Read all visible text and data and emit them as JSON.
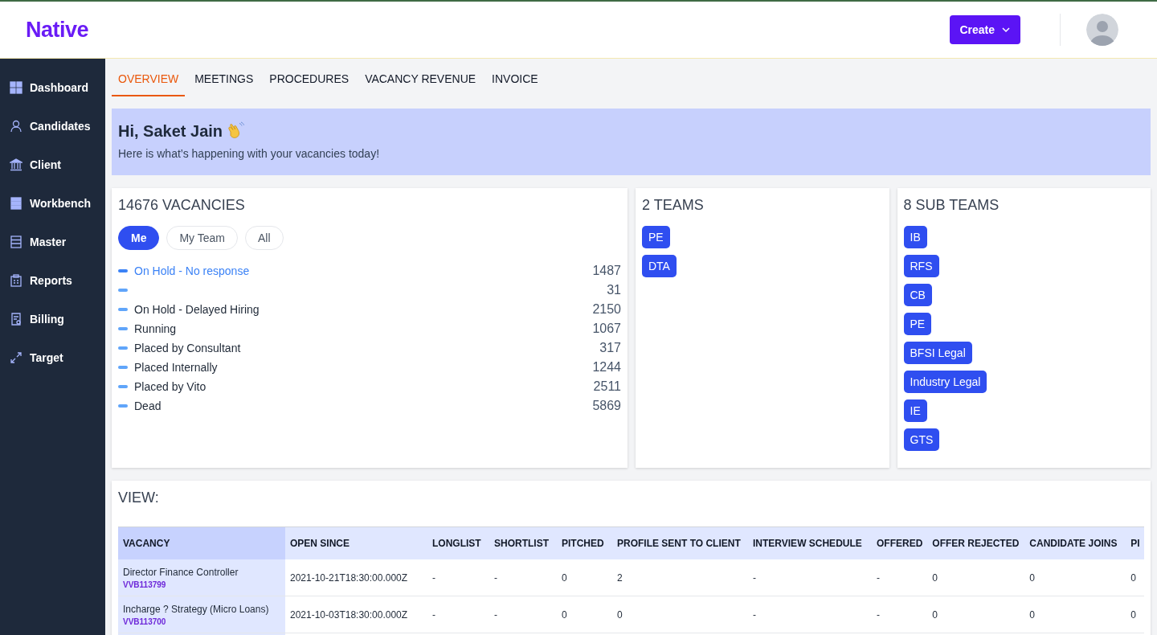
{
  "header": {
    "logo": "Native",
    "create_button": "Create"
  },
  "sidebar": {
    "items": [
      {
        "label": "Dashboard",
        "selected": false
      },
      {
        "label": "Candidates",
        "selected": false
      },
      {
        "label": "Client",
        "selected": false
      },
      {
        "label": "Workbench",
        "selected": false
      },
      {
        "label": "Master",
        "selected": false
      },
      {
        "label": "Reports",
        "selected": false
      },
      {
        "label": "Billing",
        "selected": false
      },
      {
        "label": "Target",
        "selected": false
      }
    ]
  },
  "tabs": [
    {
      "label": "OVERVIEW",
      "selected": true
    },
    {
      "label": "MEETINGS",
      "selected": false
    },
    {
      "label": "PROCEDURES",
      "selected": false
    },
    {
      "label": "VACANCY REVENUE",
      "selected": false
    },
    {
      "label": "INVOICE",
      "selected": false
    }
  ],
  "banner": {
    "title": "Hi, Saket Jain",
    "subtitle": "Here is what’s happening with your vacancies today!"
  },
  "vacancies": {
    "title": "14676 VACANCIES",
    "filters": [
      {
        "label": "Me",
        "selected": true
      },
      {
        "label": "My Team",
        "selected": false
      },
      {
        "label": "All",
        "selected": false
      }
    ],
    "statuses": [
      {
        "label": "On Hold - No response",
        "count": "1487",
        "selected": true
      },
      {
        "count": "31",
        "selected": false
      },
      {
        "label": "On Hold - Delayed Hiring",
        "count": "2150",
        "selected": false
      },
      {
        "label": "Running",
        "count": "1067",
        "selected": false
      },
      {
        "label": "Placed by Consultant",
        "count": "317",
        "selected": false
      },
      {
        "label": "Placed Internally",
        "count": "1244",
        "selected": false
      },
      {
        "label": "Placed by Vito",
        "count": "2511",
        "selected": false
      },
      {
        "label": "Dead",
        "count": "5869",
        "selected": false
      }
    ]
  },
  "teams": {
    "title": "2 TEAMS",
    "items": [
      "PE",
      "DTA"
    ]
  },
  "sub_teams": {
    "title": "8 SUB TEAMS",
    "items": [
      "IB",
      "RFS",
      "CB",
      "PE",
      "BFSI Legal",
      "Industry Legal",
      "IE",
      "GTS"
    ]
  },
  "view": {
    "title": "VIEW:",
    "table": {
      "columns": [
        "VACANCY",
        "OPEN SINCE",
        "LONGLIST",
        "SHORTLIST",
        "PITCHED",
        "PROFILE SENT TO CLIENT",
        "INTERVIEW SCHEDULE",
        "OFFERED",
        "OFFER REJECTED",
        "CANDIDATE JOINS",
        "PI"
      ],
      "rows": [
        {
          "cells": [
            {
              "text": "Director Finance Controller",
              "code": "VVB113799"
            },
            "2021-10-21T18:30:00.000Z",
            "-",
            "-",
            "0",
            "2",
            "-",
            "-",
            "0",
            "0",
            "0"
          ]
        },
        {
          "cells": [
            {
              "text": "Incharge ? Strategy (Micro Loans)",
              "code": "VVB113700"
            },
            "2021-10-03T18:30:00.000Z",
            "-",
            "-",
            "0",
            "0",
            "-",
            "-",
            "0",
            "0",
            "0"
          ]
        }
      ]
    }
  }
}
